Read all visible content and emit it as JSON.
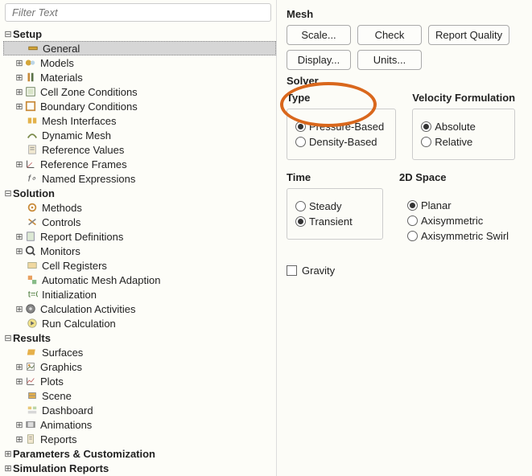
{
  "filter": {
    "placeholder": "Filter Text"
  },
  "tree": {
    "setup": {
      "label": "Setup"
    },
    "general": {
      "label": "General"
    },
    "models": {
      "label": "Models"
    },
    "materials": {
      "label": "Materials"
    },
    "czc": {
      "label": "Cell Zone Conditions"
    },
    "bc": {
      "label": "Boundary Conditions"
    },
    "mi": {
      "label": "Mesh Interfaces"
    },
    "dm": {
      "label": "Dynamic Mesh"
    },
    "rv": {
      "label": "Reference Values"
    },
    "rf": {
      "label": "Reference Frames"
    },
    "ne": {
      "label": "Named Expressions"
    },
    "solution": {
      "label": "Solution"
    },
    "methods": {
      "label": "Methods"
    },
    "controls": {
      "label": "Controls"
    },
    "rd": {
      "label": "Report Definitions"
    },
    "monitors": {
      "label": "Monitors"
    },
    "cr": {
      "label": "Cell Registers"
    },
    "ama": {
      "label": "Automatic Mesh Adaption"
    },
    "init": {
      "label": "Initialization"
    },
    "ca": {
      "label": "Calculation Activities"
    },
    "rc": {
      "label": "Run Calculation"
    },
    "results": {
      "label": "Results"
    },
    "surfaces": {
      "label": "Surfaces"
    },
    "graphics": {
      "label": "Graphics"
    },
    "plots": {
      "label": "Plots"
    },
    "scene": {
      "label": "Scene"
    },
    "dashboard": {
      "label": "Dashboard"
    },
    "animations": {
      "label": "Animations"
    },
    "reports": {
      "label": "Reports"
    },
    "pc": {
      "label": "Parameters & Customization"
    },
    "sr": {
      "label": "Simulation Reports"
    }
  },
  "mesh": {
    "title": "Mesh",
    "scale": "Scale...",
    "check": "Check",
    "rq": "Report Quality",
    "display": "Display...",
    "units": "Units..."
  },
  "solver": {
    "title": "Solver",
    "type": {
      "title": "Type",
      "pressure": "Pressure-Based",
      "density": "Density-Based"
    },
    "vf": {
      "title": "Velocity Formulation",
      "absolute": "Absolute",
      "relative": "Relative"
    },
    "time": {
      "title": "Time",
      "steady": "Steady",
      "transient": "Transient"
    },
    "space": {
      "title": "2D Space",
      "planar": "Planar",
      "axi": "Axisymmetric",
      "axis": "Axisymmetric Swirl"
    }
  },
  "gravity": {
    "label": "Gravity"
  }
}
